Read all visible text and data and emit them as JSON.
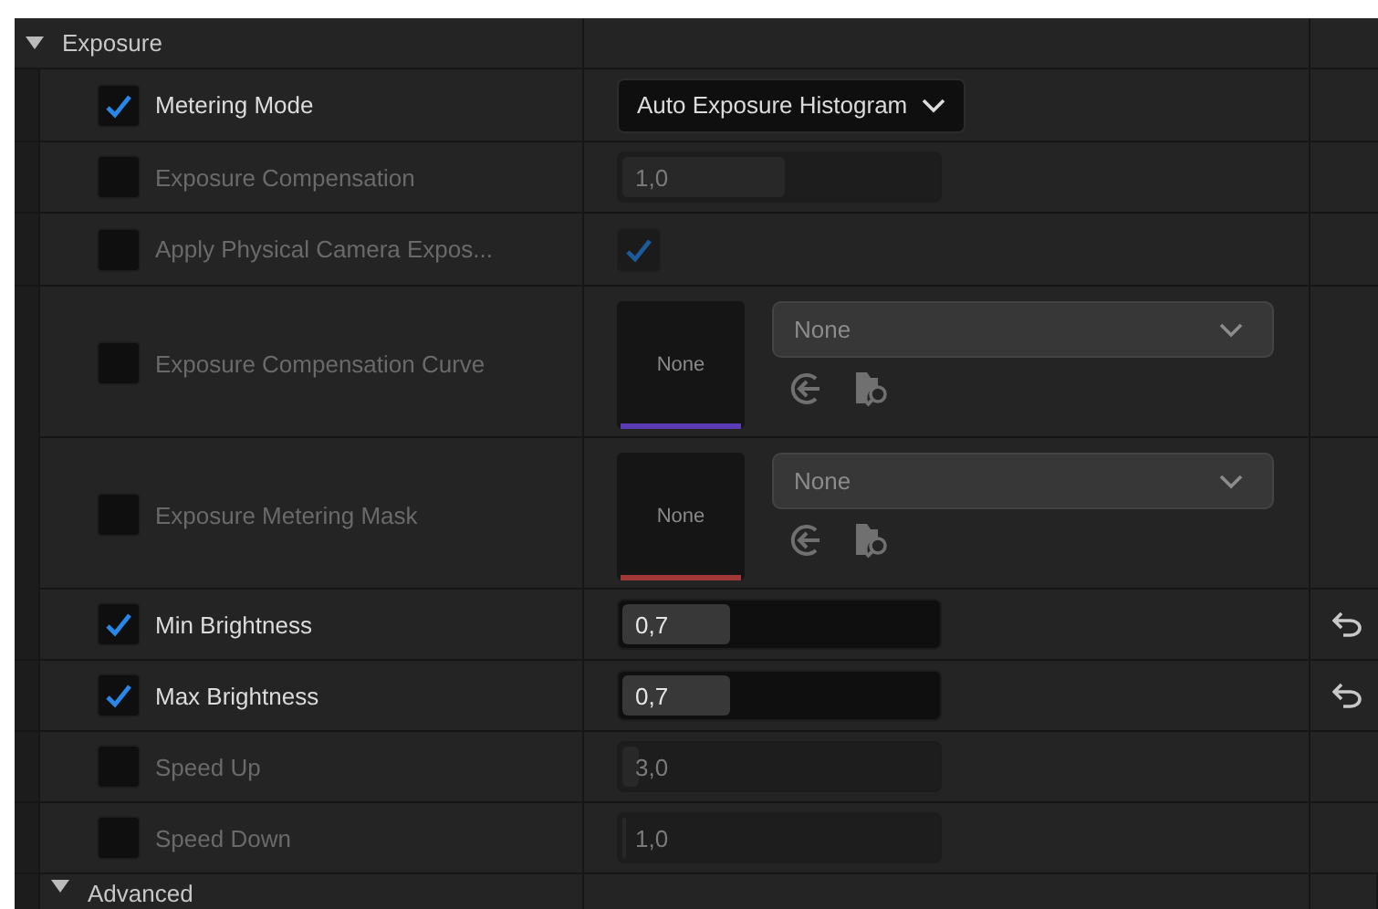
{
  "section": {
    "title": "Exposure",
    "expanded": true
  },
  "rows": [
    {
      "kind": "dropdown",
      "label": "Metering Mode",
      "enabled": true,
      "value": "Auto Exposure Histogram"
    },
    {
      "kind": "number",
      "label": "Exposure Compensation",
      "enabled": false,
      "value": "1,0",
      "level": 0.51
    },
    {
      "kind": "checkbox",
      "label": "Apply Physical Camera Expos...",
      "enabled": false,
      "checked": true
    },
    {
      "kind": "asset",
      "label": "Exposure Compensation Curve",
      "enabled": false,
      "thumb": "None",
      "value": "None",
      "color": "#5a3cb4"
    },
    {
      "kind": "asset",
      "label": "Exposure Metering Mask",
      "enabled": false,
      "thumb": "None",
      "value": "None",
      "color": "#a03838"
    },
    {
      "kind": "number",
      "label": "Min Brightness",
      "enabled": true,
      "value": "0,7",
      "level": 0.34,
      "reset": true
    },
    {
      "kind": "number",
      "label": "Max Brightness",
      "enabled": true,
      "value": "0,7",
      "level": 0.34,
      "reset": true
    },
    {
      "kind": "number",
      "label": "Speed Up",
      "enabled": false,
      "value": "3,0",
      "level": 0.05
    },
    {
      "kind": "number",
      "label": "Speed Down",
      "enabled": false,
      "value": "1,0",
      "level": 0.01
    }
  ],
  "next_section": {
    "title": "Advanced",
    "expanded": true
  }
}
